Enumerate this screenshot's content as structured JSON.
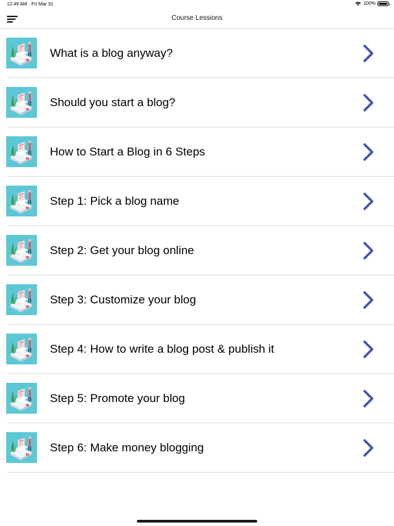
{
  "status_bar": {
    "time": "12:49 AM",
    "date": "Fri Mar 31",
    "battery": "100%",
    "battery_level": 1.0,
    "wifi_icon": "wifi-icon",
    "battery_icon": "battery-icon"
  },
  "nav": {
    "title": "Course Lessions",
    "menu_icon": "menu-icon"
  },
  "colors": {
    "chevron": "#4254b3",
    "thumb_bg": "#5cc8d6"
  },
  "lessons": [
    {
      "title": "What is a blog anyway?"
    },
    {
      "title": "Should you start a blog?"
    },
    {
      "title": "How to Start a Blog in 6 Steps"
    },
    {
      "title": "Step 1: Pick a blog name"
    },
    {
      "title": "Step 2: Get your blog online"
    },
    {
      "title": "Step 3: Customize your blog"
    },
    {
      "title": "Step 4: How to write a blog post & publish it"
    },
    {
      "title": "Step 5: Promote your blog"
    },
    {
      "title": "Step 6: Make money blogging"
    }
  ]
}
